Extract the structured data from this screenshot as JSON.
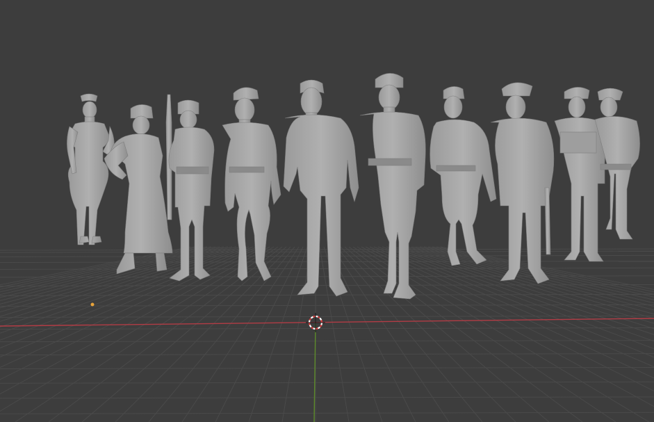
{
  "viewport": {
    "background_color": "#3d3d3d",
    "grid_color": "#4a4a4a",
    "x_axis_color": "#b23c45",
    "y_axis_color": "#5c8a2a",
    "model_color": "#a9a9a9",
    "model_shadow_color": "#8c8c8c",
    "cursor_colors": [
      "#ffffff",
      "#d23c3c"
    ],
    "origin_color": "#e8a33a"
  },
  "scene": {
    "figures": [
      {
        "id": "figure-1",
        "attire": "field-uniform",
        "headwear": "cap"
      },
      {
        "id": "figure-2",
        "attire": "long-coat",
        "headwear": "fur-hat"
      },
      {
        "id": "figure-3",
        "attire": "winter-jacket",
        "headwear": "fur-hat",
        "prop": "rifle"
      },
      {
        "id": "figure-4",
        "attire": "field-uniform",
        "headwear": "side-cap"
      },
      {
        "id": "figure-5",
        "attire": "double-breasted-coat",
        "headwear": "none"
      },
      {
        "id": "figure-6",
        "attire": "field-uniform-belt",
        "headwear": "beret"
      },
      {
        "id": "figure-7",
        "attire": "field-uniform",
        "headwear": "side-cap"
      },
      {
        "id": "figure-8",
        "attire": "greatcoat",
        "headwear": "beret",
        "prop": "cane"
      },
      {
        "id": "figure-9",
        "attire": "tunic",
        "headwear": "beret"
      },
      {
        "id": "figure-10",
        "attire": "tunic",
        "headwear": "beret"
      }
    ]
  }
}
